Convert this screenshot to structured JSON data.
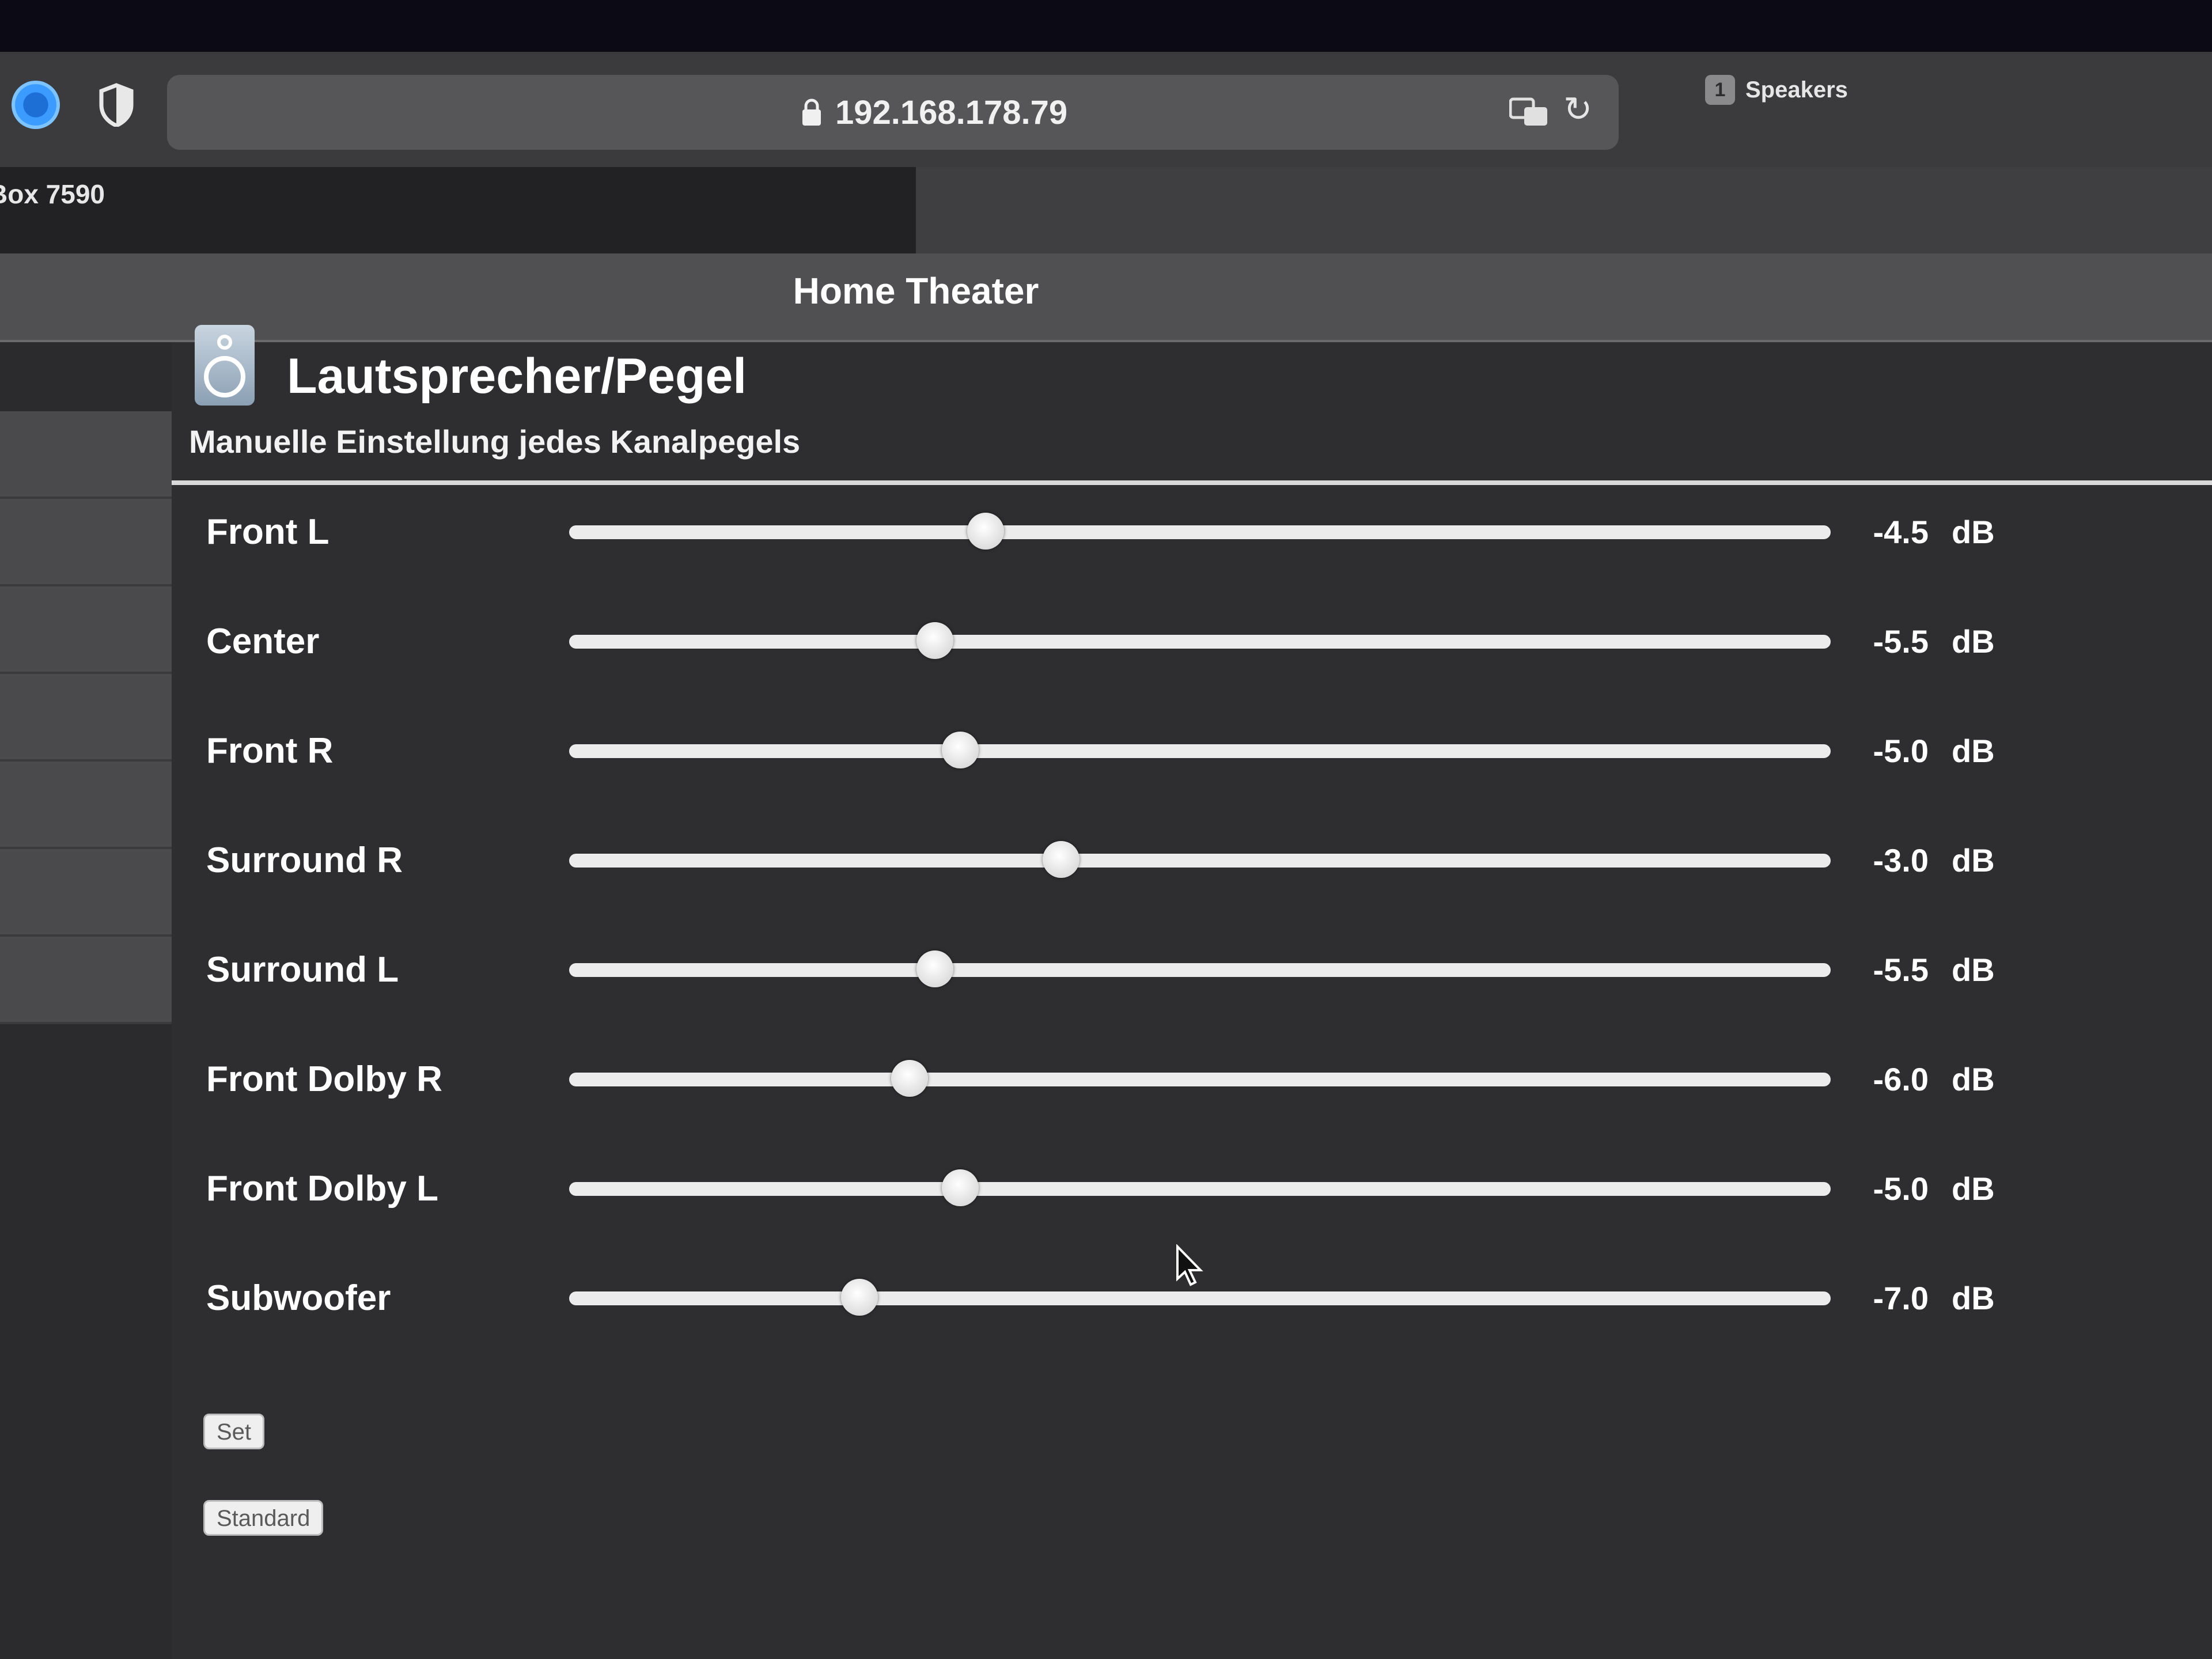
{
  "browser": {
    "url": "192.168.178.79",
    "active_tab_title": "Box 7590",
    "other_tab_badge": "1",
    "other_tab_title": "Speakers"
  },
  "page": {
    "title": "Home Theater"
  },
  "section": {
    "title": "Lautsprecher/Pegel",
    "subtitle": "Manuelle Einstellung jedes Kanalpegels"
  },
  "channels": [
    {
      "label": "Front L",
      "value": "-4.5",
      "unit": "dB",
      "level": 0.33
    },
    {
      "label": "Center",
      "value": "-5.5",
      "unit": "dB",
      "level": 0.29
    },
    {
      "label": "Front R",
      "value": "-5.0",
      "unit": "dB",
      "level": 0.31
    },
    {
      "label": "Surround R",
      "value": "-3.0",
      "unit": "dB",
      "level": 0.39
    },
    {
      "label": "Surround L",
      "value": "-5.5",
      "unit": "dB",
      "level": 0.29
    },
    {
      "label": "Front Dolby R",
      "value": "-6.0",
      "unit": "dB",
      "level": 0.27
    },
    {
      "label": "Front Dolby L",
      "value": "-5.0",
      "unit": "dB",
      "level": 0.31
    },
    {
      "label": "Subwoofer",
      "value": "-7.0",
      "unit": "dB",
      "level": 0.23
    }
  ],
  "buttons": {
    "set_label": "Set",
    "standard_label": "Standard"
  }
}
